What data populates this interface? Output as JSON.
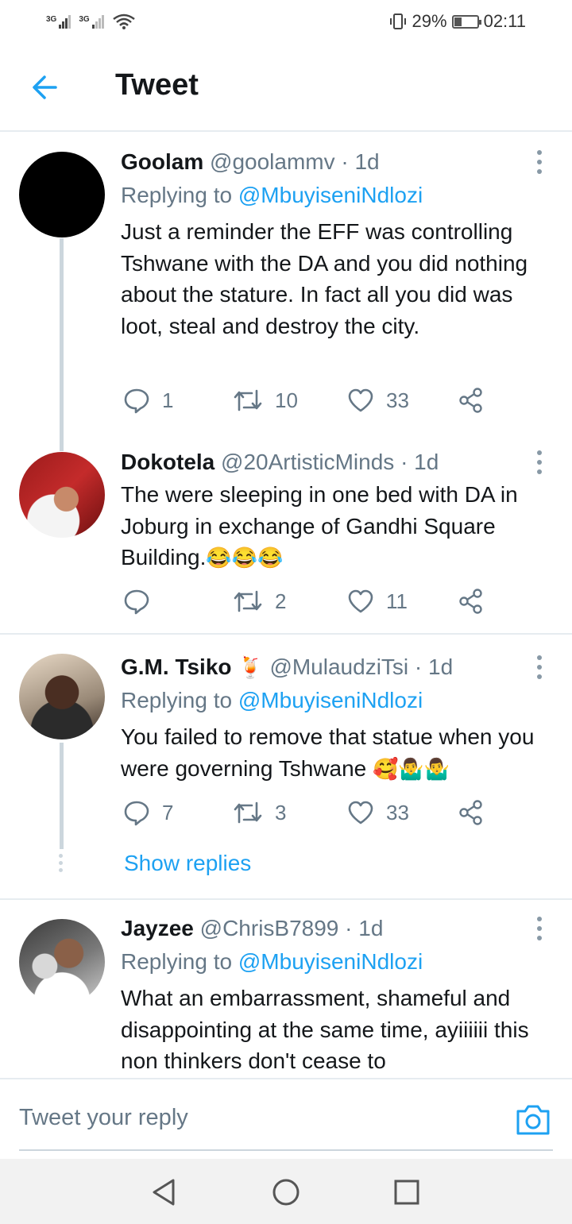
{
  "status_bar": {
    "net1": "3G",
    "net2": "3G",
    "battery": "29%",
    "time": "02:11"
  },
  "header": {
    "title": "Tweet"
  },
  "tweets": [
    {
      "name": "Goolam",
      "handle": "@goolammv · 1d",
      "replying_prefix": "Replying to ",
      "replying_to": "@MbuyiseniNdlozi",
      "text": "Just a reminder the EFF was controlling Tshwane with the DA and you did nothing about the stature. In fact all you did was loot, steal and destroy the city.",
      "replies": "1",
      "retweets": "10",
      "likes": "33"
    },
    {
      "name": "Dokotela",
      "handle": "@20ArtisticMinds · 1d",
      "text": "The were sleeping in one bed with DA in Joburg in exchange of Gandhi Square Building.",
      "emoji": "😂😂😂",
      "replies": "",
      "retweets": "2",
      "likes": "11"
    },
    {
      "name": "G.M. Tsiko",
      "name_emoji": "🍹",
      "handle": "@MulaudziTsi · 1d",
      "replying_prefix": "Replying to ",
      "replying_to": "@MbuyiseniNdlozi",
      "text": "You failed to remove that statue when you were governing Tshwane",
      "emoji": "🥰🤷‍♂️🤷‍♂️",
      "replies": "7",
      "retweets": "3",
      "likes": "33",
      "show_replies": "Show replies"
    },
    {
      "name": "Jayzee",
      "handle": "@ChrisB7899 · 1d",
      "replying_prefix": "Replying to ",
      "replying_to": "@MbuyiseniNdlozi",
      "text": "What an embarrassment, shameful and disappointing at the same time, ayiiiiii this non thinkers don't cease to"
    }
  ],
  "reply_bar": {
    "placeholder": "Tweet your reply"
  },
  "colors": {
    "accent": "#1da1f2",
    "muted": "#657786",
    "divider": "#e6ecf0"
  },
  "icons": [
    "back-arrow-icon",
    "more-vertical-icon",
    "reply-icon",
    "retweet-icon",
    "like-icon",
    "share-icon",
    "camera-icon",
    "nav-back-icon",
    "nav-home-icon",
    "nav-recents-icon"
  ]
}
